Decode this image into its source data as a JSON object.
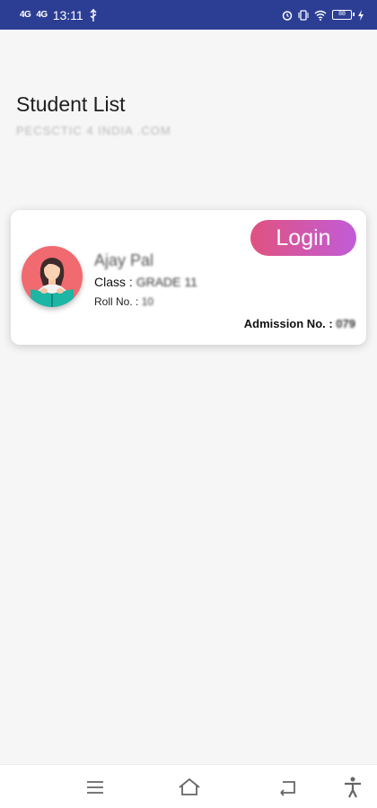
{
  "status_bar": {
    "signal1": "4G",
    "signal2": "4G",
    "time": "13:11",
    "battery": "88"
  },
  "header": {
    "title": "Student List",
    "subtitle": "PECSCTIC 4 INDIA .COM"
  },
  "student_card": {
    "name": "Ajay Pal",
    "class_label": "Class : ",
    "class_value": "GRADE 11",
    "roll_label": "Roll No. : ",
    "roll_value": "10",
    "admission_label": "Admission No. : ",
    "admission_value": "079",
    "login_label": "Login",
    "avatar_icon": "student-reading-avatar-icon",
    "avatar_color": "#f06a6f",
    "login_gradient": [
      "#e0527f",
      "#c15cd8"
    ]
  },
  "nav_bar": {
    "menu_icon": "menu-icon",
    "home_icon": "home-icon",
    "back_icon": "back-icon",
    "accessibility_icon": "accessibility-icon"
  },
  "colors": {
    "status_bar": "#2c3e94",
    "background": "#f6f6f6"
  }
}
